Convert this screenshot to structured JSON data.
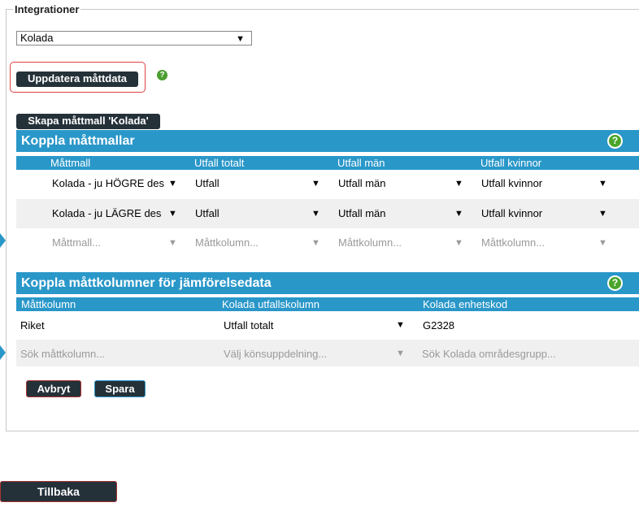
{
  "fieldset": {
    "legend": "Integrationer"
  },
  "integration_select": {
    "value": "Kolada",
    "arrow": "▼"
  },
  "update_button": {
    "label": "Uppdatera måttdata"
  },
  "help_small": {
    "glyph": "?"
  },
  "create_template_button": {
    "label": "Skapa måttmall 'Kolada'"
  },
  "section1": {
    "title": "Koppla måttmallar",
    "help_glyph": "?",
    "columns": [
      "Måttmall",
      "Utfall totalt",
      "Utfall män",
      "Utfall kvinnor"
    ],
    "rows": [
      {
        "template": "Kolada - ju HÖGRE des",
        "total": "Utfall",
        "men": "Utfall män",
        "women": "Utfall kvinnor"
      },
      {
        "template": "Kolada - ju LÄGRE des",
        "total": "Utfall",
        "men": "Utfall män",
        "women": "Utfall kvinnor"
      }
    ],
    "new_row": {
      "template": "Måttmall...",
      "total": "Måttkolumn...",
      "men": "Måttkolumn...",
      "women": "Måttkolumn..."
    }
  },
  "section2": {
    "title": "Koppla måttkolumner för jämförelsedata",
    "help_glyph": "?",
    "columns": [
      "Måttkolumn",
      "Kolada utfallskolumn",
      "Kolada enhetskod"
    ],
    "rows": [
      {
        "column": "Riket",
        "outcome": "Utfall totalt",
        "unit": "G2328"
      }
    ],
    "new_row": {
      "column": "Sök måttkolumn...",
      "outcome": "Välj könsuppdelning...",
      "unit": "Sök Kolada områdesgrupp..."
    }
  },
  "actions": {
    "cancel": "Avbryt",
    "save": "Spara"
  },
  "back_button": {
    "label": "Tillbaka"
  },
  "colors": {
    "header_blue": "#2a97c9",
    "button_dark": "#253139",
    "help_green": "#4aa52a",
    "highlight_red": "#e04040"
  }
}
